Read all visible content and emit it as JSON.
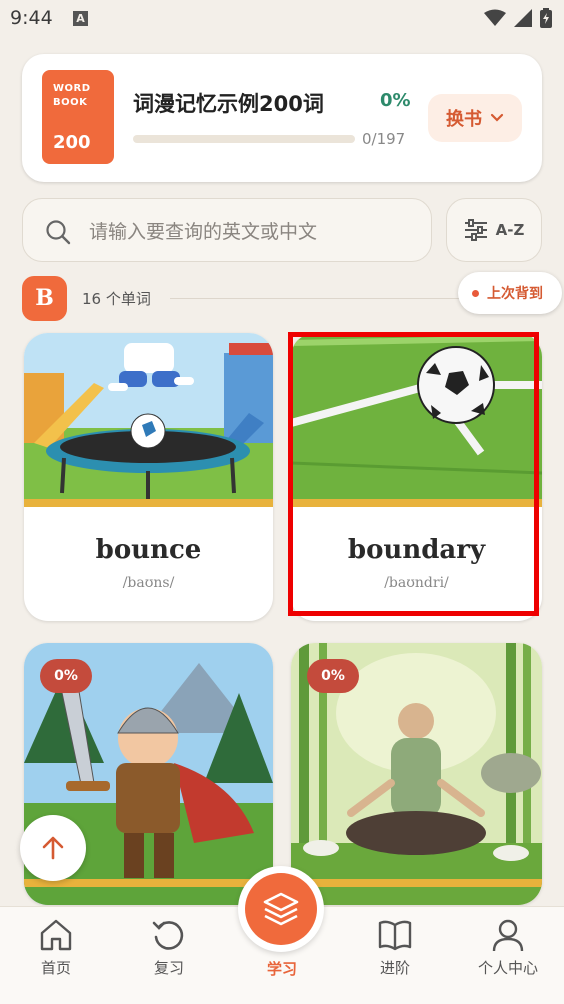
{
  "status_bar": {
    "time": "9:44",
    "a_icon": "A"
  },
  "book": {
    "cover_tag": "WORD BOOK",
    "cover_number": "200",
    "title": "词漫记忆示例200词",
    "progress_percent": "0%",
    "progress_fraction": 0,
    "progress_count": "0/197",
    "switch_label": "换书"
  },
  "search": {
    "placeholder": "请输入要查询的英文或中文",
    "sort_label": "A-Z"
  },
  "section": {
    "letter": "B",
    "count_label": "16 个单词",
    "last_label": "上次背到"
  },
  "cards": [
    {
      "word": "bounce",
      "phonetic": "/baʊns/"
    },
    {
      "word": "boundary",
      "phonetic": "/baʊndri/"
    },
    {
      "badge": "0%"
    },
    {
      "badge": "0%"
    }
  ],
  "nav": {
    "items": [
      {
        "label": "首页",
        "icon": "home-icon"
      },
      {
        "label": "复习",
        "icon": "review-icon"
      },
      {
        "label": "学习",
        "icon": "layers-icon"
      },
      {
        "label": "进阶",
        "icon": "book-icon"
      },
      {
        "label": "个人中心",
        "icon": "user-icon"
      }
    ]
  },
  "colors": {
    "accent": "#f06a3c",
    "progress": "#2d8a6b",
    "highlight": "#ee0000"
  }
}
